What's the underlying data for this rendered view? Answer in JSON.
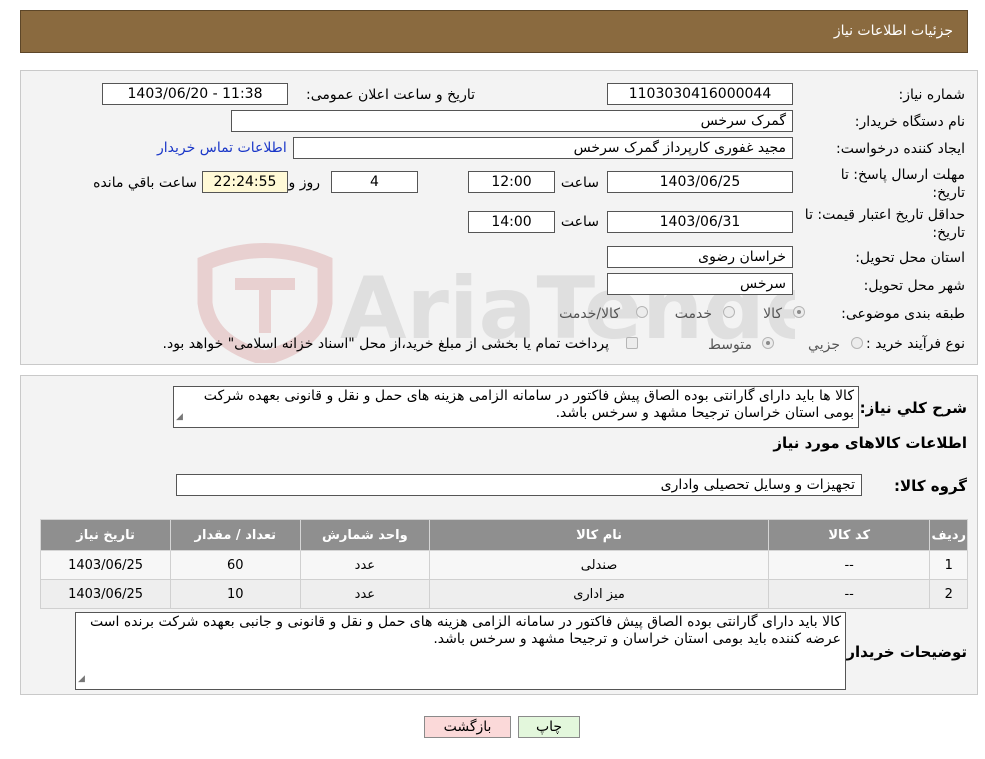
{
  "header": {
    "title": "جزئیات اطلاعات نیاز"
  },
  "form": {
    "need_number_label": "شماره نیاز:",
    "need_number": "1103030416000044",
    "announce_label": "تاریخ و ساعت اعلان عمومی:",
    "announce_value": "1403/06/20 - 11:38",
    "buyer_org_label": "نام دستگاه خریدار:",
    "buyer_org": "گمرک سرخس",
    "creator_label": "ایجاد کننده درخواست:",
    "creator": "مجید غفوری کارپرداز گمرک سرخس",
    "contact_link": "اطلاعات تماس خریدار",
    "deadline_label": "مهلت ارسال پاسخ: تا تاریخ:",
    "deadline_date": "1403/06/25",
    "time_label": "ساعت",
    "deadline_time": "12:00",
    "days_value": "4",
    "days_label": "روز و",
    "remaining_time": "22:24:55",
    "remaining_label": "ساعت باقي مانده",
    "validity_label": "حداقل تاریخ اعتبار قیمت: تا تاریخ:",
    "validity_date": "1403/06/31",
    "validity_time_label": "ساعت",
    "validity_time": "14:00",
    "province_label": "استان محل تحویل:",
    "province": "خراسان رضوی",
    "city_label": "شهر محل تحویل:",
    "city": "سرخس",
    "category_label": "طبقه بندی موضوعی:",
    "category_options": [
      "کالا",
      "خدمت",
      "کالا/خدمت"
    ],
    "process_label": "نوع فرآیند خرید :",
    "process_options": [
      "جزیي",
      "متوسط"
    ],
    "process_note": "پرداخت تمام يا بخشی از مبلغ خريد،از محل \"اسناد خزانه اسلامی\" خواهد بود."
  },
  "summary": {
    "label": "شرح کلي نياز:",
    "text": "کالا ها باید دارای گارانتی بوده الصاق پیش فاکتور در سامانه الزامی هزینه های حمل و نقل و قانونی بعهده شرکت بومی استان خراسان ترجیحا مشهد و سرخس باشد.",
    "items_heading": "اطلاعات کالاهای مورد نیاز",
    "group_label": "گروه کالا:",
    "group_value": "تجهیزات و وسایل تحصیلی واداری"
  },
  "table": {
    "headers": [
      "ردیف",
      "کد کالا",
      "نام کالا",
      "واحد شمارش",
      "تعداد / مقدار",
      "تاریخ نیاز"
    ],
    "rows": [
      [
        "1",
        "--",
        "صندلی",
        "عدد",
        "60",
        "1403/06/25"
      ],
      [
        "2",
        "--",
        "میز اداری",
        "عدد",
        "10",
        "1403/06/25"
      ]
    ]
  },
  "buyer_notes": {
    "label": "توضیحات خریدار:",
    "text": "کالا باید دارای گارانتی بوده الصاق پیش فاکتور در سامانه الزامی هزینه های حمل و نقل و قانونی و جانبی بعهده شرکت برنده است عرضه کننده باید بومی استان خراسان و ترجیحا مشهد و سرخس باشد."
  },
  "buttons": {
    "print": "چاپ",
    "back": "بازگشت"
  },
  "watermark": {
    "text": "AriaTender.neT"
  },
  "colors": {
    "header_bg": "#8a6a3f",
    "link": "#1a37c8",
    "back_button_bg": "#fbd9d9",
    "print_button_bg": "#e3f7dc"
  }
}
